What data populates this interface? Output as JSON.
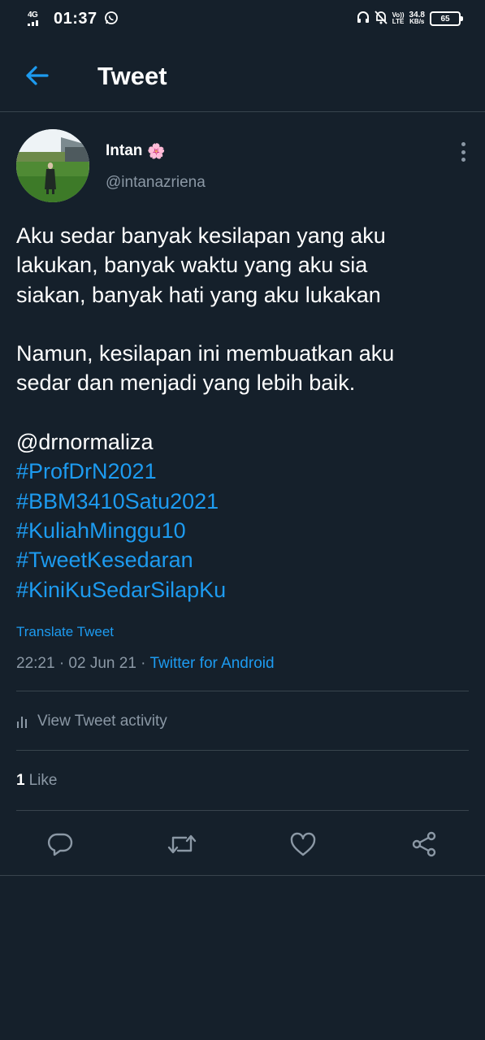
{
  "status_bar": {
    "network": "4G",
    "time": "01:37",
    "volte_top": "Vo))",
    "volte_bottom": "LTE",
    "speed_value": "34.8",
    "speed_unit": "KB/s",
    "battery": "65"
  },
  "header": {
    "title": "Tweet"
  },
  "tweet": {
    "author": {
      "name": "Intan",
      "emoji": "🌸",
      "handle": "@intanazriena"
    },
    "body": {
      "p1": [
        "Aku sedar banyak kesilapan yang aku",
        "lakukan, banyak waktu yang aku sia",
        "siakan, banyak hati yang aku lukakan"
      ],
      "p2": [
        "Namun, kesilapan ini membuatkan aku",
        "sedar dan menjadi yang lebih baik."
      ],
      "mention": "@drnormaliza",
      "hashtags": [
        "#ProfDrN2021",
        "#BBM3410Satu2021",
        "#KuliahMinggu10",
        "#TweetKesedaran",
        "#KiniKuSedarSilapKu"
      ]
    },
    "translate_label": "Translate Tweet",
    "timestamp": "22:21 · 02 Jun 21 · ",
    "source": "Twitter for Android",
    "activity_label": "View Tweet activity",
    "likes_count": "1",
    "likes_label": "Like"
  },
  "icons": {
    "back": "arrow-left-icon",
    "more": "more-vertical-icon",
    "activity": "bar-chart-icon",
    "reply": "comment-icon",
    "retweet": "retweet-icon",
    "like": "heart-icon",
    "share": "share-icon"
  },
  "colors": {
    "background": "#15202b",
    "accent": "#1d9bf0",
    "secondary_text": "#8b98a5",
    "divider": "#38444d"
  }
}
